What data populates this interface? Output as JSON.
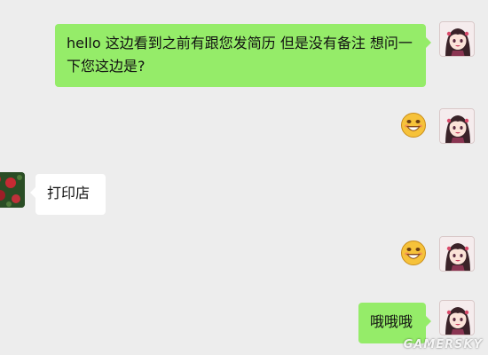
{
  "messages": [
    {
      "from": "self",
      "text": "hello 这边看到之前有跟您发简历 但是没有备注 想问一下您这边是?"
    },
    {
      "from": "self",
      "sticker": "grin-emoji"
    },
    {
      "from": "other",
      "text": "打印店"
    },
    {
      "from": "self",
      "sticker": "grin-emoji"
    },
    {
      "from": "self",
      "text": "哦哦哦"
    }
  ],
  "watermark": "GAMERSKY",
  "colors": {
    "background": "#ededed",
    "outgoing_bubble": "#95ec69",
    "incoming_bubble": "#ffffff",
    "text": "#111111"
  },
  "icons": {
    "self_avatar": "anime-girl-avatar",
    "other_avatar": "red-flowers-avatar",
    "sticker": "grin-emoji"
  }
}
